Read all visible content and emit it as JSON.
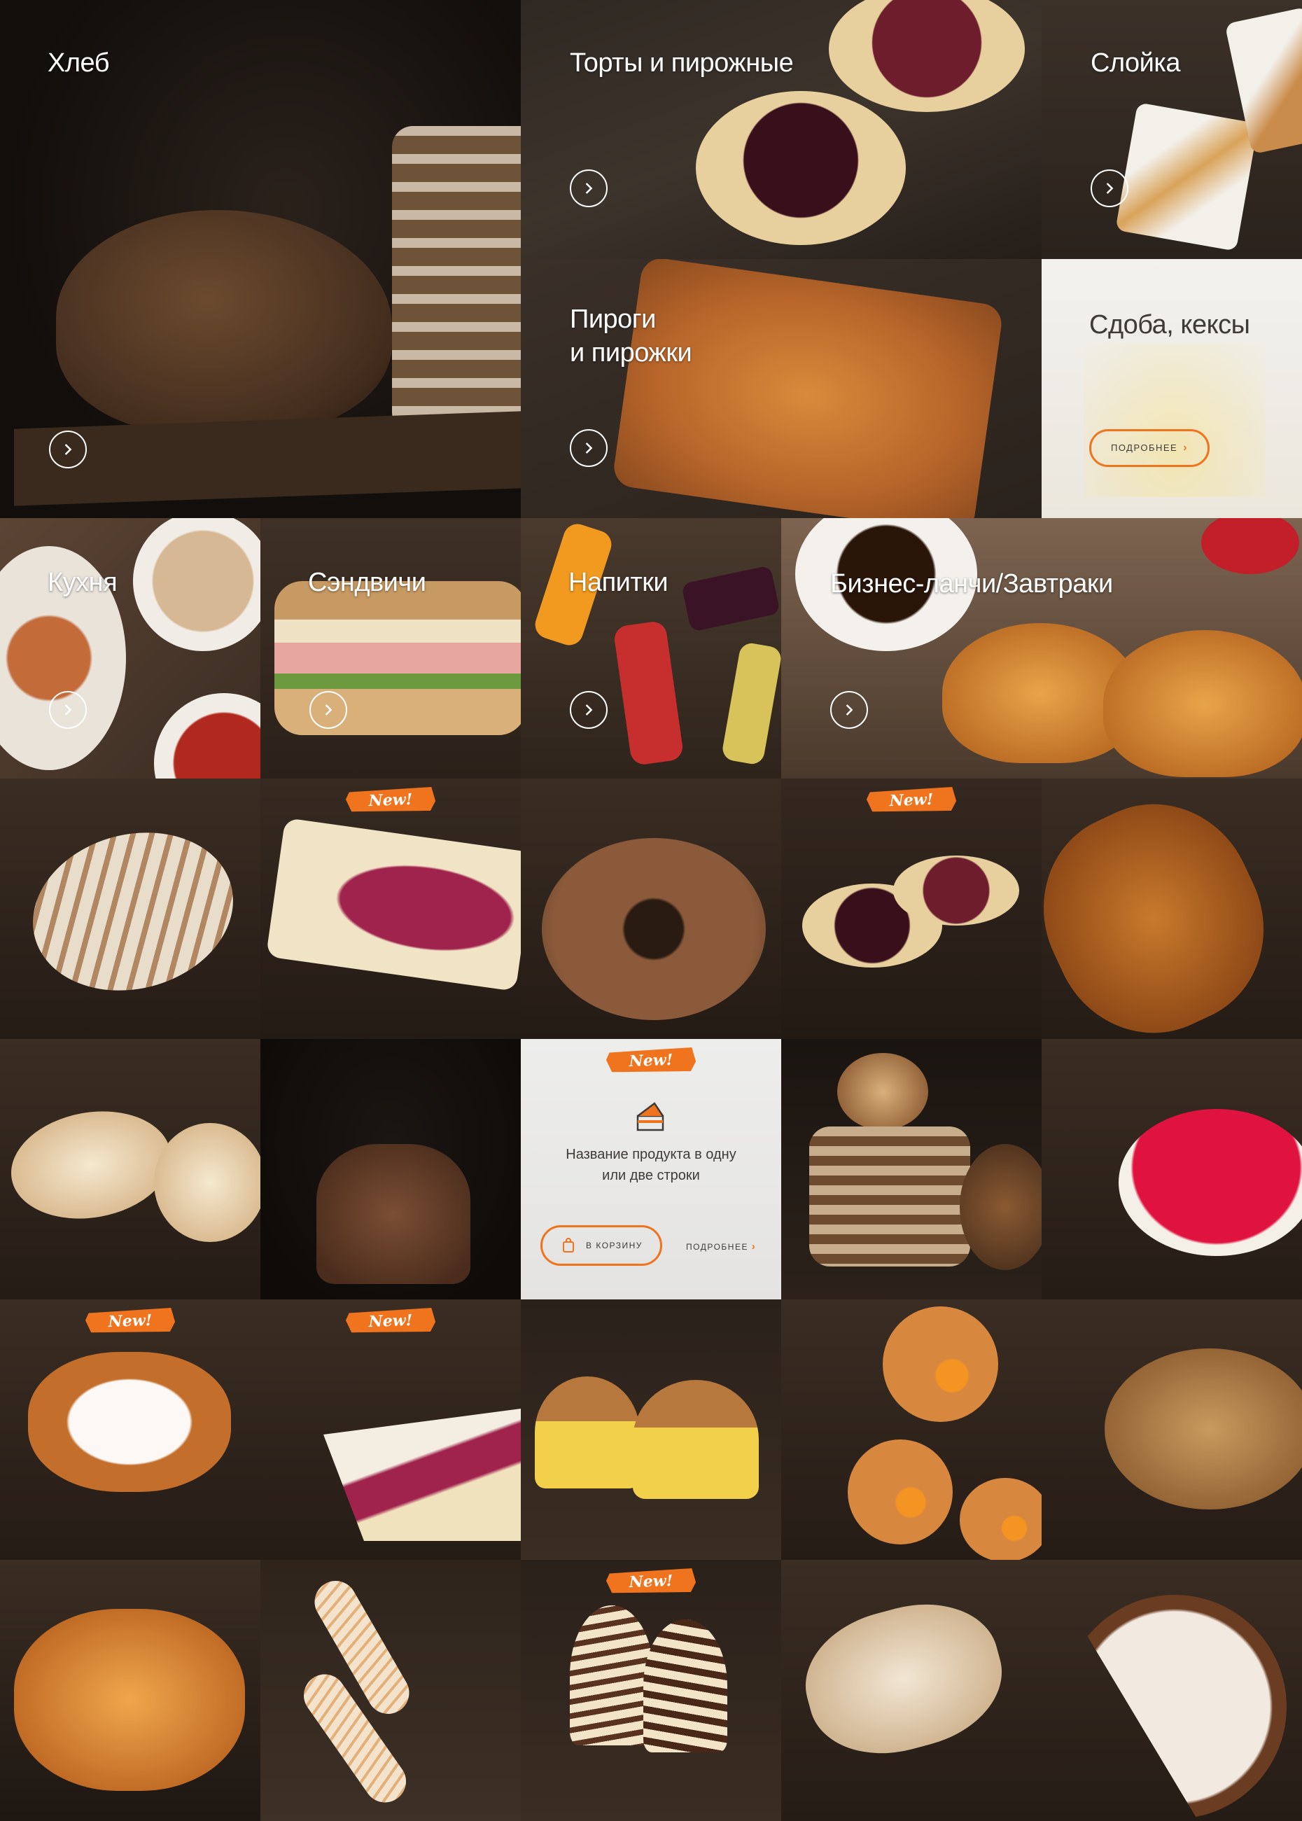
{
  "categories": {
    "bread": {
      "title": "Хлеб"
    },
    "cakes": {
      "title": "Торты и пирожные"
    },
    "puff": {
      "title": "Слойка"
    },
    "pies": {
      "title": "Пироги\nи пирожки"
    },
    "muffins": {
      "title": "Сдоба, кексы",
      "more_label": "ПОДРОБНЕЕ"
    },
    "kitchen": {
      "title": "Кухня"
    },
    "sandwiches": {
      "title": "Сэндвичи"
    },
    "drinks": {
      "title": "Напитки"
    },
    "business": {
      "title": "Бизнес-ланчи/Завтраки"
    }
  },
  "badges": {
    "new": "New!"
  },
  "product_card": {
    "badge": "New!",
    "name": "Название продукта в одну\nили две строки",
    "cart_label": "В КОРЗИНУ",
    "more_label": "ПОДРОБНЕЕ",
    "icon": "cake-slice-icon"
  },
  "colors": {
    "accent": "#f0731d",
    "dark_bg": "#2a211b",
    "light_card": "#ececeb",
    "text_dark": "#3e3a37"
  }
}
